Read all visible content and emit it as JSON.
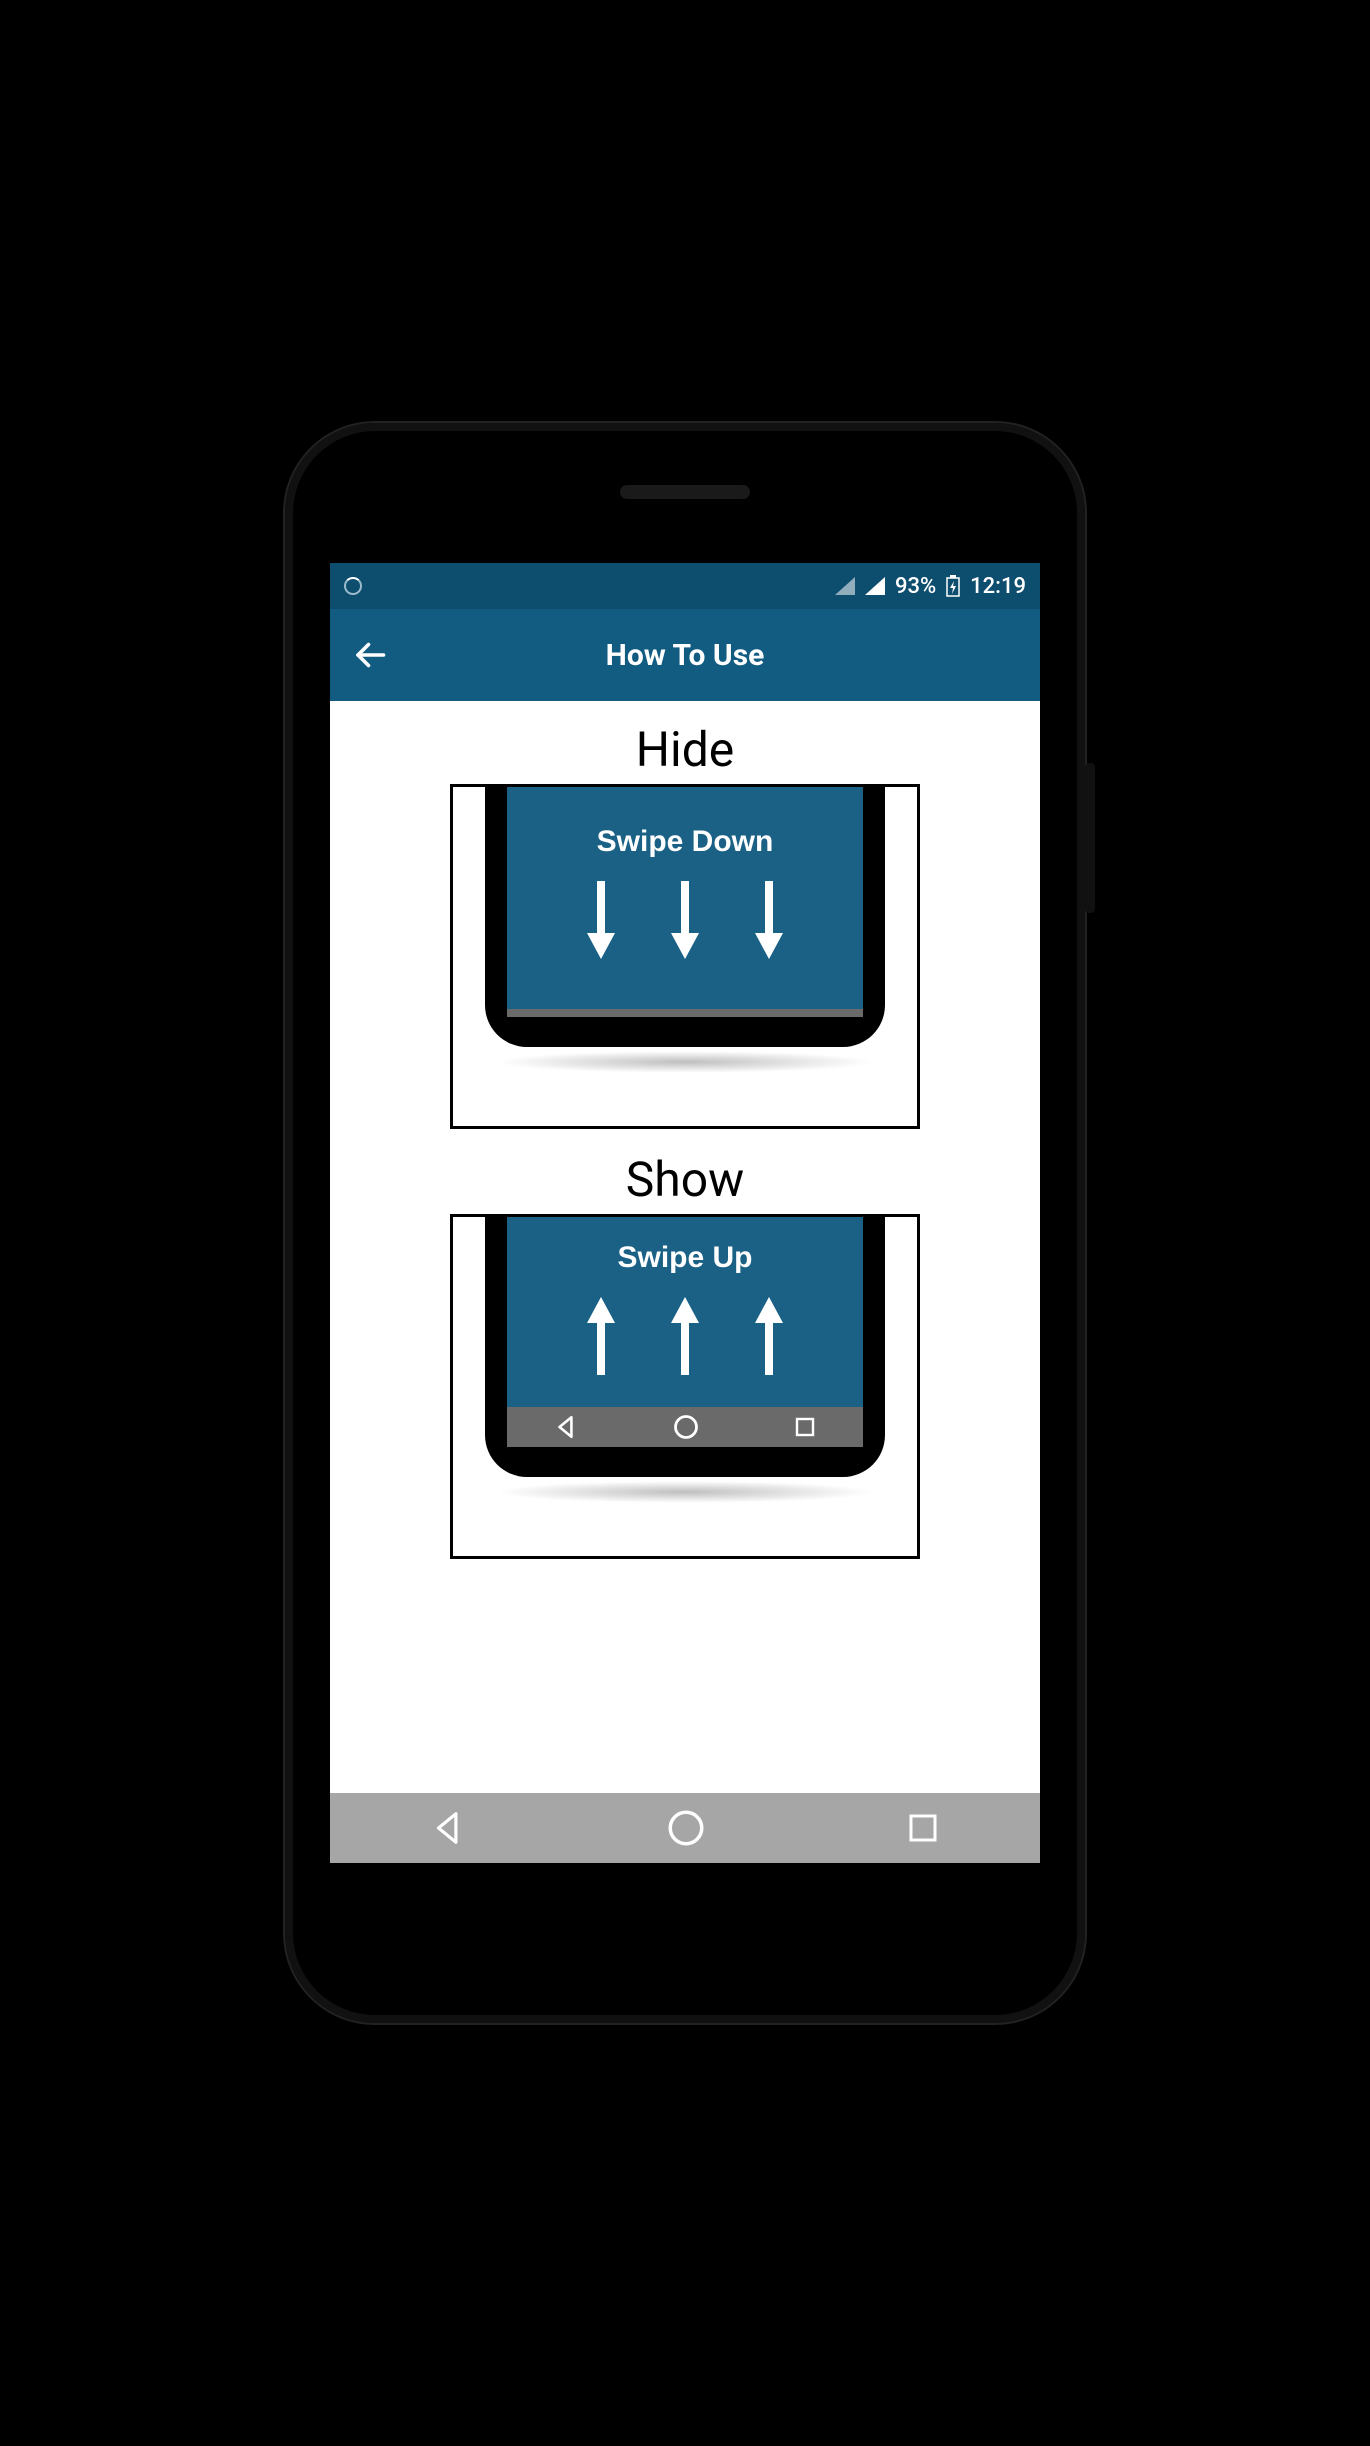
{
  "statusbar": {
    "battery_percent": "93%",
    "time": "12:19"
  },
  "appbar": {
    "title": "How To Use"
  },
  "sections": {
    "hide": {
      "title": "Hide",
      "gesture_label": "Swipe Down"
    },
    "show": {
      "title": "Show",
      "gesture_label": "Swipe Up"
    }
  },
  "colors": {
    "status_bg": "#0d4d6e",
    "appbar_bg": "#125c82",
    "mini_screen_bg": "#1b6186",
    "sysnav_bg": "#a6a6a6"
  }
}
